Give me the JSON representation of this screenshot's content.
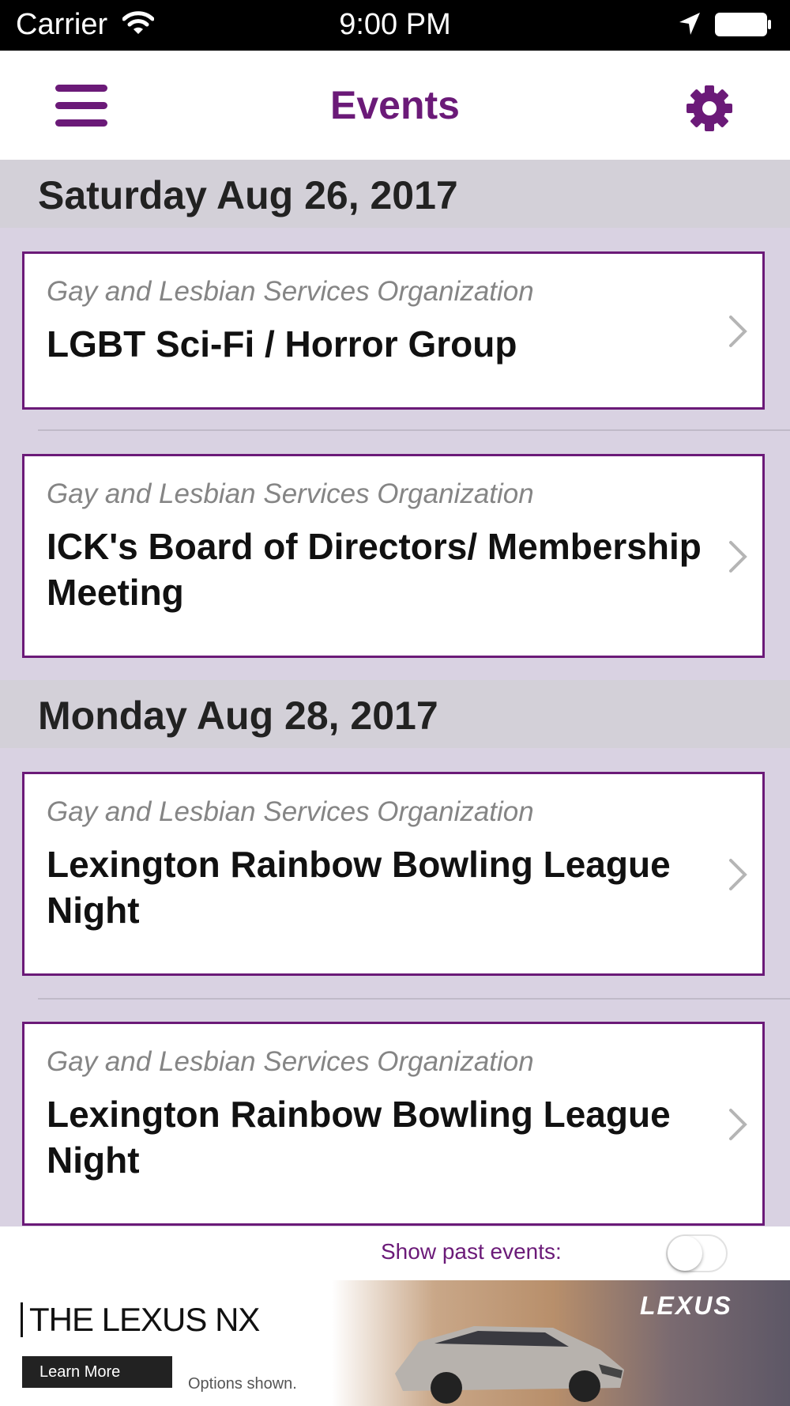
{
  "status_bar": {
    "carrier": "Carrier",
    "time": "9:00 PM",
    "icons": [
      "wifi-icon",
      "location-arrow-icon",
      "battery-icon"
    ]
  },
  "nav": {
    "title": "Events",
    "left_icon": "hamburger-menu-icon",
    "right_icon": "gear-icon"
  },
  "sections": [
    {
      "date": "Saturday Aug 26, 2017",
      "events": [
        {
          "org": "Gay and Lesbian Services Organization",
          "title": "LGBT Sci-Fi / Horror Group"
        },
        {
          "org": "Gay and Lesbian Services Organization",
          "title": "ICK's Board of Directors/ Membership Meeting"
        }
      ]
    },
    {
      "date": "Monday Aug 28, 2017",
      "events": [
        {
          "org": "Gay and Lesbian Services Organization",
          "title": "Lexington Rainbow Bowling League Night"
        },
        {
          "org": "Gay and Lesbian Services Organization",
          "title": "Lexington Rainbow Bowling League Night"
        }
      ]
    }
  ],
  "footer": {
    "show_past_label": "Show past events:",
    "show_past_on": false
  },
  "ad": {
    "headline": "THE LEXUS NX",
    "cta": "Learn More",
    "note": "Options shown.",
    "brand": "LEXUS"
  },
  "colors": {
    "accent": "#6b1a78",
    "list_background": "#d9d2e2",
    "section_header": "#d3d0d8"
  }
}
